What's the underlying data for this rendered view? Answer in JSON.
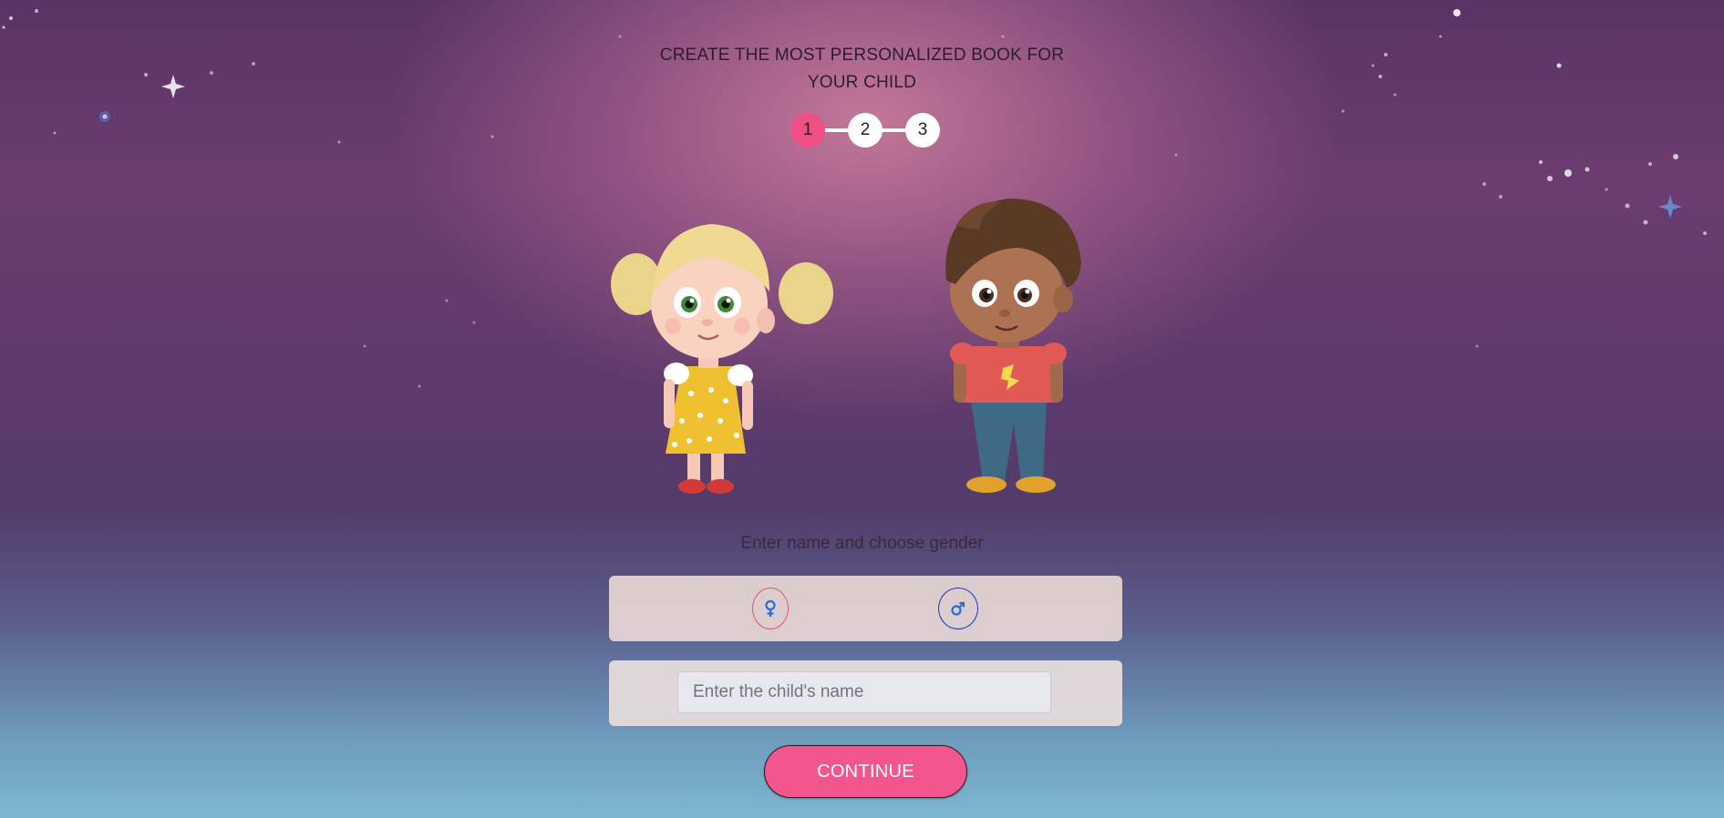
{
  "header": {
    "title_line1": "CREATE THE MOST PERSONALIZED BOOK FOR",
    "title_line2": "YOUR CHILD"
  },
  "stepper": {
    "steps": [
      "1",
      "2",
      "3"
    ],
    "active_step": 1,
    "active_color": "#f04f86"
  },
  "characters": {
    "girl": "girl-character-illustration",
    "boy": "boy-character-illustration"
  },
  "form": {
    "instruction": "Enter name and choose gender",
    "gender_female_icon": "female-symbol-icon",
    "gender_male_icon": "male-symbol-icon",
    "name_placeholder": "Enter the child's name",
    "name_value": ""
  },
  "continue_label": "CONTINUE",
  "colors": {
    "accent": "#f2568c",
    "female": "#e2556f",
    "male": "#2233cc",
    "gender_icon": "#2b6fd6"
  }
}
